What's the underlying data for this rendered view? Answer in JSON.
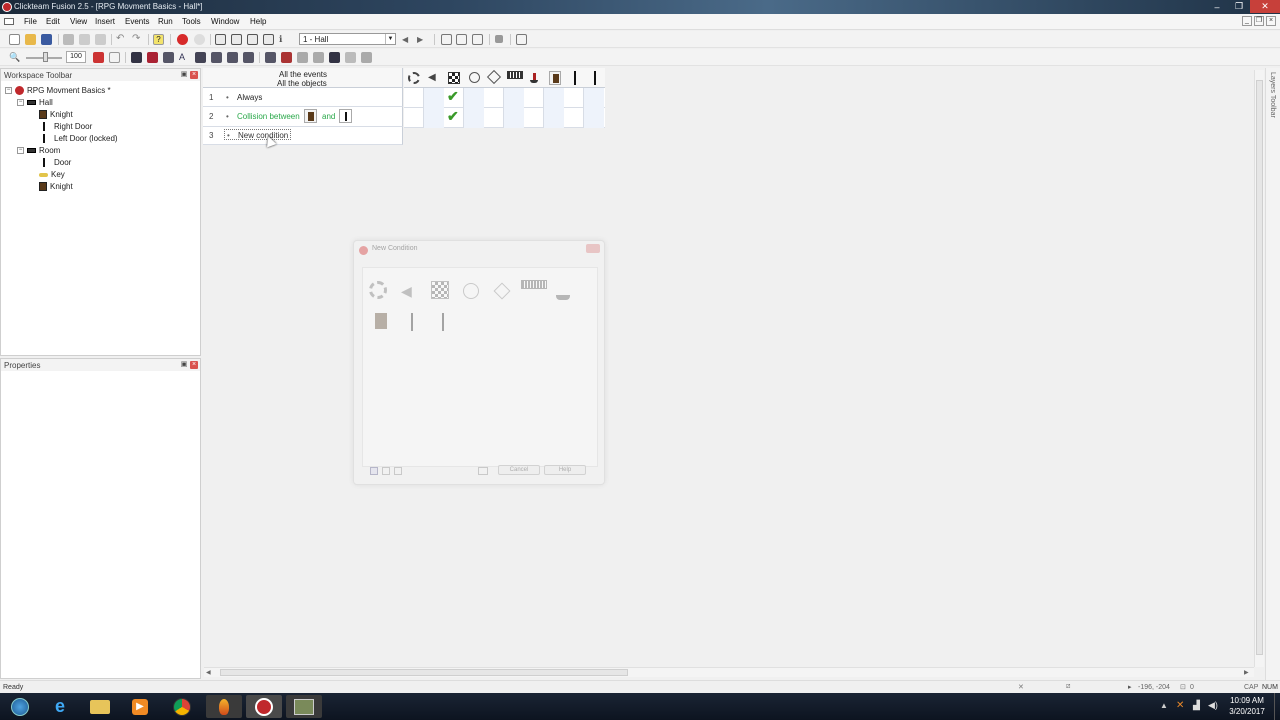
{
  "window": {
    "title": "Clickteam Fusion 2.5 - [RPG Movment Basics - Hall*]",
    "controls": [
      "–",
      "❐",
      "✕"
    ]
  },
  "menu": {
    "items": [
      "File",
      "Edit",
      "View",
      "Insert",
      "Events",
      "Run",
      "Tools",
      "Window",
      "Help"
    ]
  },
  "toolbar": {
    "zoom_value": "100",
    "frame_select": "1 - Hall"
  },
  "workspace": {
    "title": "Workspace Toolbar",
    "tree": {
      "root": "RPG Movment Basics *",
      "frames": [
        {
          "name": "Hall",
          "objects": [
            "Knight",
            "Right Door",
            "Left Door (locked)"
          ]
        },
        {
          "name": "Room",
          "objects": [
            "Door",
            "Key",
            "Knight"
          ]
        }
      ]
    }
  },
  "properties": {
    "title": "Properties"
  },
  "event_editor": {
    "header_line1": "All the events",
    "header_line2": "All the objects",
    "rows": [
      {
        "num": "1",
        "text": "Always"
      },
      {
        "num": "2",
        "text": "Collision between",
        "and_text": "and"
      },
      {
        "num": "3",
        "text": "New condition"
      }
    ],
    "column_icons": [
      "special-conditions-icon",
      "sound-icon",
      "storyboard-icon",
      "timer-icon",
      "create-objects-icon",
      "keyboard-mouse-icon",
      "player-icon",
      "knight-icon",
      "door-icon",
      "door-icon"
    ]
  },
  "dialog": {
    "title": "New Condition",
    "cancel_label": "Cancel",
    "help_label": "Help"
  },
  "right_toolbar": {
    "title": "Layers Toolbar"
  },
  "statusbar": {
    "status": "Ready",
    "coords": "-196, -204",
    "zero": "0",
    "caps": "CAP",
    "num": "NUM"
  },
  "taskbar": {
    "time": "10:09 AM",
    "date": "3/20/2017"
  }
}
